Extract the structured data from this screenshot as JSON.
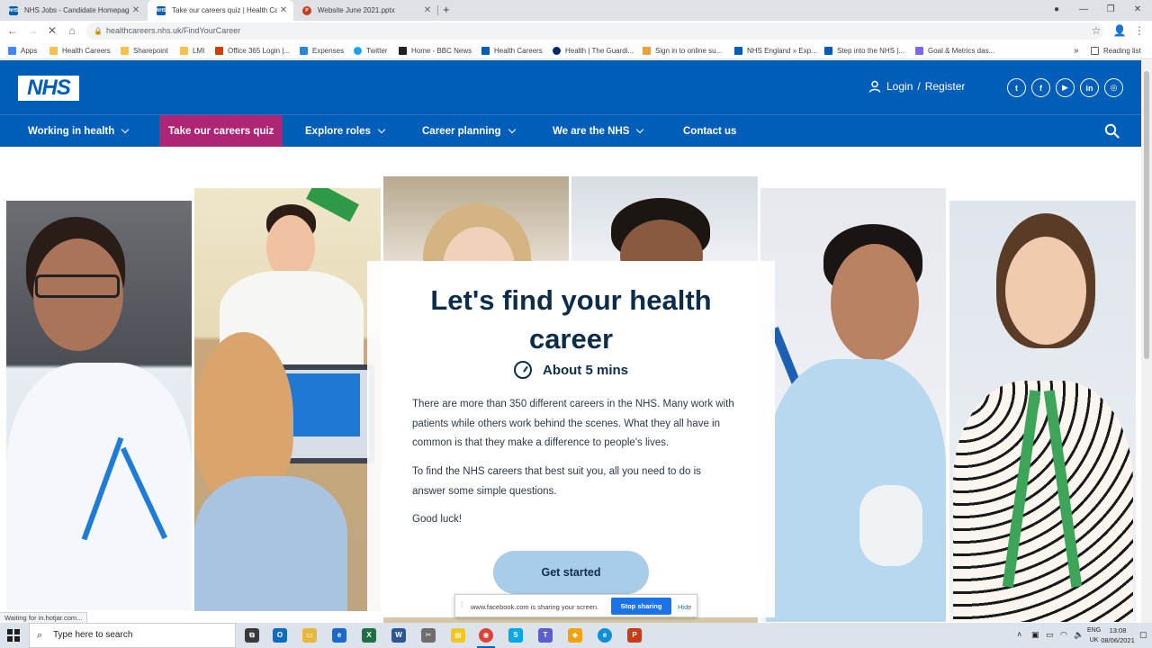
{
  "browser": {
    "tabs": [
      {
        "label": "NHS Jobs - Candidate Homepage",
        "icon": "nhs-icon",
        "active": false
      },
      {
        "label": "Take our careers quiz | Health Ca",
        "icon": "nhs-icon",
        "active": true
      },
      {
        "label": "Website June 2021.pptx",
        "icon": "powerpoint-icon",
        "active": false
      }
    ],
    "new_tab_glyph": "+",
    "url": "healthcareers.nhs.uk/FindYourCareer",
    "bookmarks": [
      {
        "label": "Apps",
        "color": "#4285f4"
      },
      {
        "label": "Health Careers",
        "color": "#f4c24d"
      },
      {
        "label": "Sharepoint",
        "color": "#f4c24d"
      },
      {
        "label": "LMI",
        "color": "#f4c24d"
      },
      {
        "label": "Office 365 Login |...",
        "color": "#d83b01"
      },
      {
        "label": "Expenses",
        "color": "#2b88d8"
      },
      {
        "label": "Twitter",
        "color": "#1da1f2"
      },
      {
        "label": "Home - BBC News",
        "color": "#222222"
      },
      {
        "label": "Health Careers",
        "color": "#005eb8"
      },
      {
        "label": "Health | The Guardi...",
        "color": "#052962"
      },
      {
        "label": "Sign in to online su...",
        "color": "#e8a33c"
      },
      {
        "label": "NHS England » Exp...",
        "color": "#005eb8"
      },
      {
        "label": "Step into the NHS |...",
        "color": "#005eb8"
      },
      {
        "label": "Goal & Metrics das...",
        "color": "#7b68ee"
      }
    ],
    "overflow_glyph": "»",
    "reading_list": "Reading list",
    "status_text": "Waiting for in.hotjar.com..."
  },
  "site": {
    "logo": "NHS",
    "login": "Login",
    "register": "Register",
    "login_sep": "/",
    "social": [
      "twitter-icon",
      "facebook-icon",
      "youtube-icon",
      "linkedin-icon",
      "instagram-icon"
    ],
    "nav": [
      {
        "label": "Working in health",
        "dropdown": true
      },
      {
        "label": "Take our careers quiz",
        "dropdown": false
      },
      {
        "label": "Explore roles",
        "dropdown": true
      },
      {
        "label": "Career planning",
        "dropdown": true
      },
      {
        "label": "We are the NHS",
        "dropdown": true
      },
      {
        "label": "Contact us",
        "dropdown": false
      }
    ],
    "colors": {
      "nhs_blue": "#005eb8",
      "quiz_pink": "#ae2573",
      "dark_text": "#0b2d4a",
      "button": "#a9cde8"
    }
  },
  "card": {
    "title_line1": "Let's find your health",
    "title_line2": "career",
    "duration": "About 5 mins",
    "para1": "There are more than 350 different careers in the NHS. Many work with patients while others work behind the scenes. What they all have in common is that they make a difference to people's lives.",
    "para2": "To find the NHS careers that best suit you, all you need to do is answer some simple questions.",
    "para3": "Good luck!",
    "button": "Get started"
  },
  "share_bar": {
    "message": "www.facebook.com is sharing your screen.",
    "stop": "Stop sharing",
    "hide": "Hide"
  },
  "taskbar": {
    "search_placeholder": "Type here to search",
    "lang_line1": "ENG",
    "lang_line2": "UK",
    "time": "13:08",
    "date": "08/06/2021"
  }
}
